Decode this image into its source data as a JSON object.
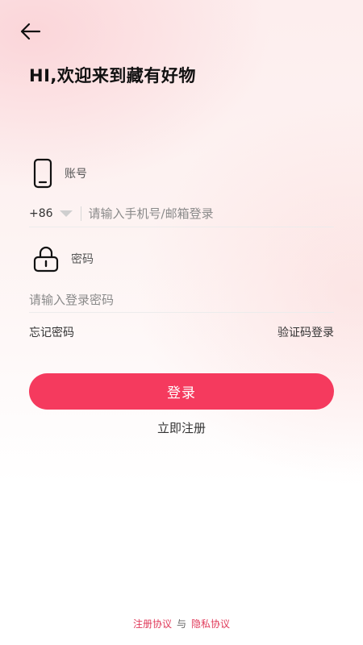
{
  "header": {
    "back_icon": "arrow-left-icon",
    "welcome": "HI,欢迎来到藏有好物"
  },
  "account": {
    "icon": "phone-icon",
    "label": "账号",
    "country_code": "+86",
    "placeholder": "请输入手机号/邮箱登录",
    "value": ""
  },
  "password": {
    "icon": "lock-icon",
    "label": "密码",
    "placeholder": "请输入登录密码",
    "value": ""
  },
  "links": {
    "forgot": "忘记密码",
    "sms_login": "验证码登录"
  },
  "actions": {
    "login": "登录",
    "register": "立即注册"
  },
  "footer": {
    "user_agreement": "注册协议",
    "conjunction": "与",
    "privacy_policy": "隐私协议"
  },
  "colors": {
    "accent": "#f53a5e",
    "link": "#e03a5a"
  }
}
